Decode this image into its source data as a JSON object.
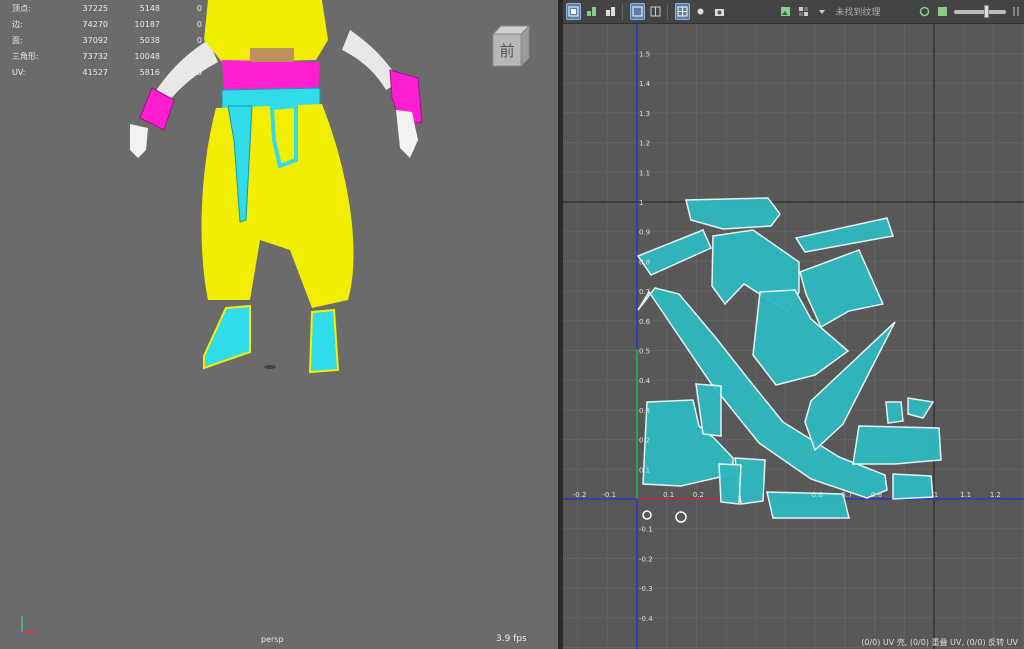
{
  "stats": [
    {
      "label": "顶点:",
      "v1": "37225",
      "v2": "5148",
      "v3": "0"
    },
    {
      "label": "边:",
      "v1": "74270",
      "v2": "10187",
      "v3": "0"
    },
    {
      "label": "面:",
      "v1": "37092",
      "v2": "5038",
      "v3": "0"
    },
    {
      "label": "三角形:",
      "v1": "73732",
      "v2": "10048",
      "v3": "0"
    },
    {
      "label": "UV:",
      "v1": "41527",
      "v2": "5816",
      "v3": "0"
    }
  ],
  "viewport": {
    "view_cube_label": "前",
    "camera": "persp",
    "fps": "3.9 fps"
  },
  "uv_toolbar": {
    "texture_placeholder": "未找到纹理"
  },
  "uv_axis": {
    "x_ticks": [
      "-0.2",
      "-0.1",
      "0.1",
      "0.2",
      "0.6",
      "0.7",
      "0.8",
      "1",
      "1.1",
      "1.2"
    ],
    "y_ticks": [
      "1.5",
      "1.4",
      "1.3",
      "1.2",
      "1.1",
      "1",
      "0.9",
      "0.8",
      "0.7",
      "0.6",
      "0.5",
      "0.4",
      "0.3",
      "0.2",
      "0.1",
      "-0.1",
      "-0.2",
      "-0.3",
      "-0.4"
    ]
  },
  "uv_status": "(0/0) UV 壳, (0/0) 重叠 UV, (0/0) 反转 UV",
  "colors": {
    "viewport_bg": "#6b6b6b",
    "uv_bg": "#585858",
    "uv_shell": "#2fb8c0",
    "character_yellow": "#f2ee00",
    "character_magenta": "#ff1ed2",
    "character_cyan": "#30dcea",
    "active_button": "#5a7ea4"
  }
}
